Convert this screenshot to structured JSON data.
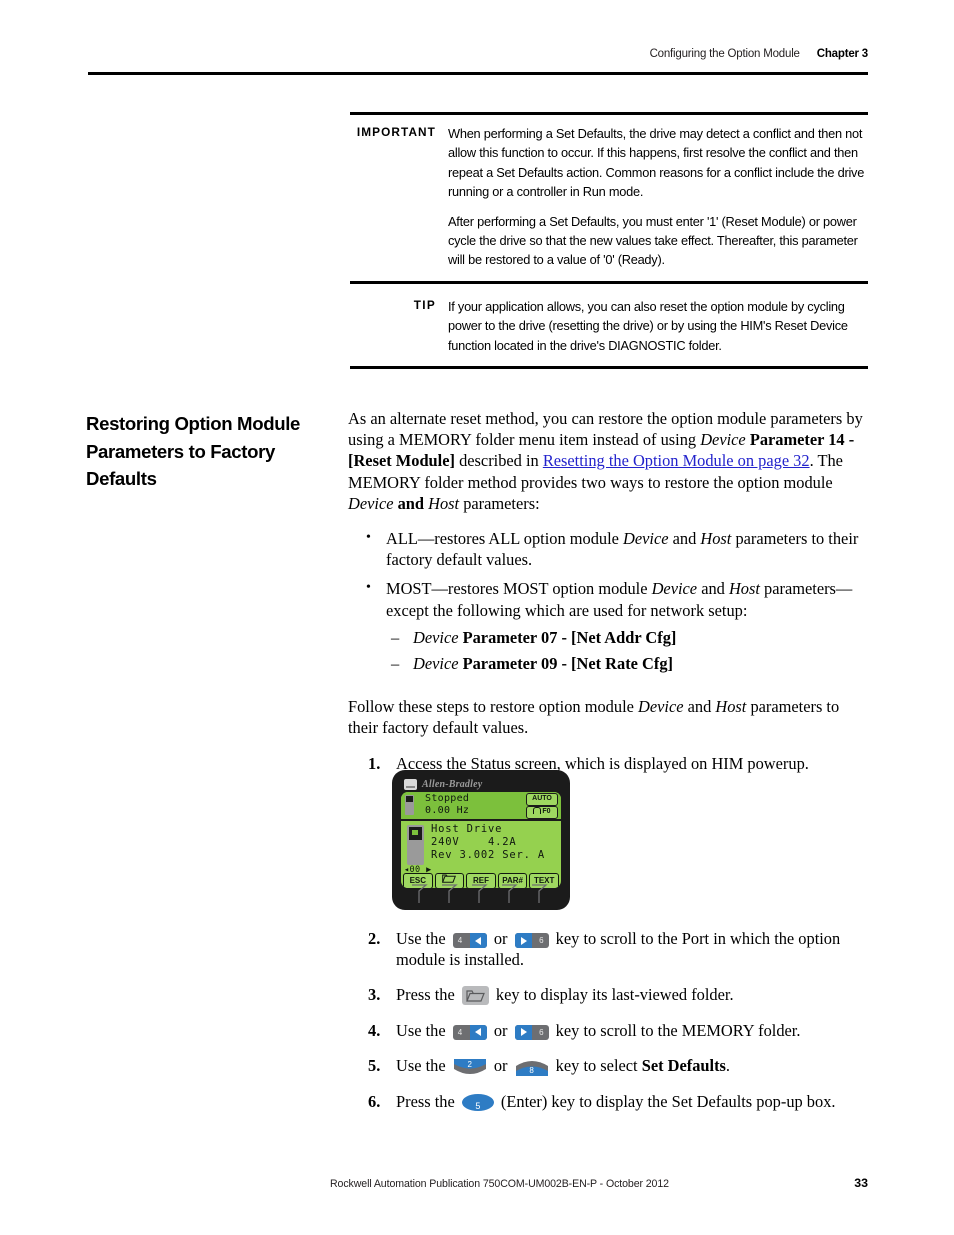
{
  "header": {
    "section": "Configuring the Option Module",
    "chapter": "Chapter 3"
  },
  "important_callout": {
    "label": "IMPORTANT",
    "paragraph1": "When performing a Set Defaults, the drive may detect a conflict and then not allow this function to occur. If this happens, first resolve the conflict and then repeat a Set Defaults action. Common reasons for a conflict include the drive running or a controller in Run mode.",
    "paragraph2": "After performing a Set Defaults, you must enter '1' (Reset Module) or power cycle the drive so that the new values take effect. Thereafter, this parameter will be restored to a value of '0' (Ready)."
  },
  "tip_callout": {
    "label": "TIP",
    "paragraph1": "If your application allows, you can also reset the option module by cycling power to the drive (resetting the drive) or by using the HIM's Reset Device function located in the drive's DIAGNOSTIC folder."
  },
  "section": {
    "heading": "Restoring Option Module Parameters to Factory Defaults"
  },
  "intro": {
    "part1": "As an alternate reset method, you can restore the option module parameters by using a MEMORY folder menu item instead of using ",
    "device1": "Device",
    "param14": " Parameter 14 - ",
    "bracket1": "[Reset Module]",
    "part2": " described in ",
    "link": "Resetting the Option Module on page 32",
    "part3": ". The MEMORY folder method provides two ways to restore the option module ",
    "device2": "Device",
    "and1": " and ",
    "host1": "Host",
    "part4": " parameters:"
  },
  "bullets": [
    {
      "pre": "ALL—restores ALL option module ",
      "device": "Device",
      "mid": " and ",
      "host": "Host",
      "post": " parameters to their factory default values."
    },
    {
      "pre": "MOST—restores MOST option module ",
      "device": "Device",
      "mid": " and ",
      "host": "Host",
      "post": " parameters—except the following which are used for network setup:"
    }
  ],
  "sub_bullets": [
    {
      "device": "Device",
      "text": " Parameter 07 - [Net Addr Cfg]"
    },
    {
      "device": "Device",
      "text": " Parameter 09 - [Net Rate Cfg]"
    }
  ],
  "follow": {
    "part1": "Follow these steps to restore option module ",
    "device": "Device",
    "and": " and ",
    "host": "Host",
    "part2": " parameters to their factory default values."
  },
  "steps": {
    "step1": {
      "num": "1.",
      "text": "Access the Status screen, which is displayed on HIM powerup."
    },
    "step2": {
      "num": "2.",
      "pre": "Use the ",
      "or": " or ",
      "post": " key to scroll to the Port in which the option module is installed."
    },
    "step3": {
      "num": "3.",
      "pre": "Press the ",
      "post": " key to display its last-viewed folder."
    },
    "step4": {
      "num": "4.",
      "pre": "Use the ",
      "or": " or ",
      "post": " key to scroll to the MEMORY folder."
    },
    "step5": {
      "num": "5.",
      "pre": "Use the ",
      "or": " or ",
      "mid": " key to select ",
      "bold": "Set Defaults",
      "post": "."
    },
    "step6": {
      "num": "6.",
      "pre": "Press the ",
      "post": " (Enter) key to display the Set Defaults pop-up box."
    }
  },
  "keys": {
    "left_digit": "4",
    "right_digit": "6",
    "down_digit": "2",
    "up_digit": "8",
    "enter_digit": "5",
    "left_icon": "left-arrow-key-icon",
    "right_icon": "right-arrow-key-icon",
    "folder_icon": "folder-key-icon",
    "down_icon": "down-arrow-key-icon",
    "up_icon": "up-arrow-key-icon",
    "enter_icon": "enter-key-icon"
  },
  "him_display": {
    "brand": "Allen-Bradley",
    "status_line1": "Stopped",
    "status_line2": "0.00 Hz",
    "badge_auto": "AUTO",
    "badge_f0": "F0",
    "main_line1": "Host Drive",
    "main_line2": "240V    4.2A",
    "main_line3": "Rev 3.002 Ser. A",
    "port_indicator": "◂00 ▶",
    "softkeys": [
      "ESC",
      "folder-icon",
      "REF",
      "PAR#",
      "TEXT"
    ]
  },
  "footer": {
    "publication": "Rockwell Automation Publication 750COM-UM002B-EN-P - October 2012",
    "page_number": "33"
  },
  "colors": {
    "link": "#2222cc",
    "key_blue": "#2e7cc4",
    "key_gray": "#6d6e71",
    "lcd_green": "#95d14f",
    "lcd_status_green": "#7cc03c"
  }
}
